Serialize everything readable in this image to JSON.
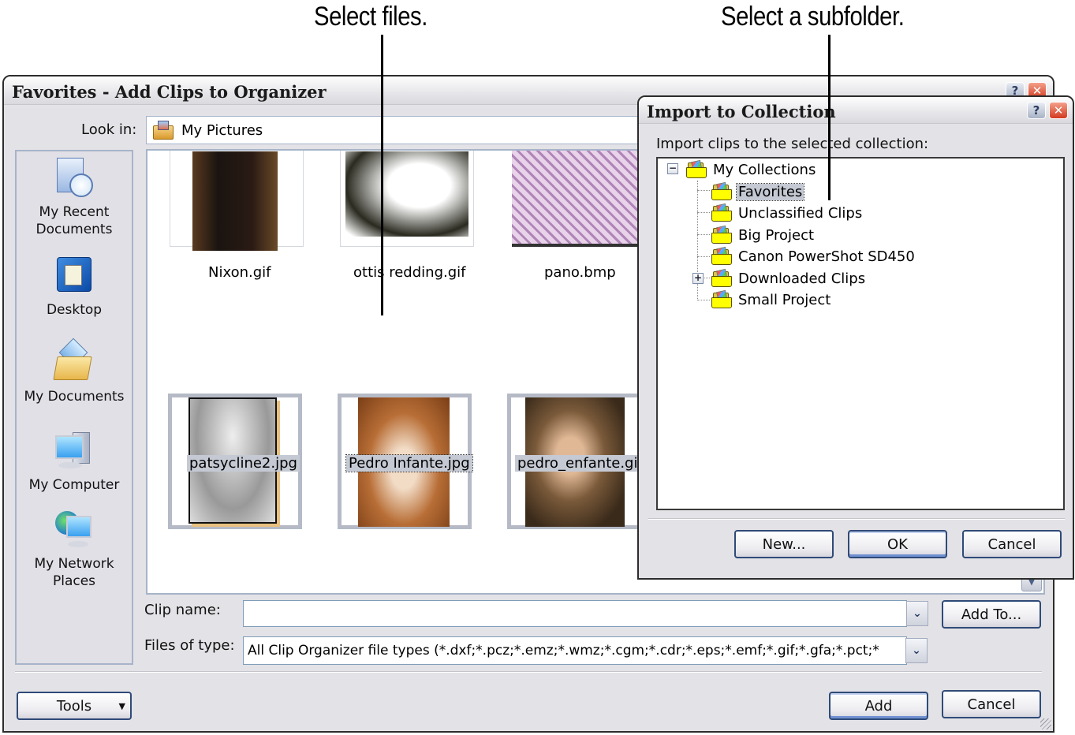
{
  "callouts": {
    "select_files": "Select files.",
    "select_subfolder": "Select a subfolder."
  },
  "main_window": {
    "title": "Favorites - Add Clips to Organizer",
    "help_label": "?",
    "close_label": "✕",
    "look_in_label": "Look in:",
    "look_in_value": "My Pictures",
    "places": [
      {
        "label": "My Recent Documents",
        "icon": "recent-documents-icon"
      },
      {
        "label": "Desktop",
        "icon": "desktop-icon"
      },
      {
        "label": "My Documents",
        "icon": "my-documents-icon"
      },
      {
        "label": "My Computer",
        "icon": "my-computer-icon"
      },
      {
        "label": "My Network Places",
        "icon": "network-places-icon"
      }
    ],
    "files": [
      {
        "name": "Nixon.gif",
        "selected": false
      },
      {
        "name": "ottis redding.gif",
        "selected": false
      },
      {
        "name": "pano.bmp",
        "selected": false
      },
      {
        "name": "patsycline2.jpg",
        "selected": true
      },
      {
        "name": "Pedro Infante.jpg",
        "selected": true,
        "focused": true
      },
      {
        "name": "pedro_enfante.gif",
        "selected": true
      }
    ],
    "clip_name_label": "Clip name:",
    "clip_name_value": "",
    "files_of_type_label": "Files of type:",
    "files_of_type_value": "All Clip Organizer file types  (*.dxf;*.pcz;*.emz;*.wmz;*.cgm;*.cdr;*.eps;*.emf;*.gif;*.gfa;*.pct;*",
    "add_to_button": "Add To...",
    "tools_button": "Tools",
    "add_button": "Add",
    "cancel_button": "Cancel"
  },
  "import_dialog": {
    "title": "Import to Collection",
    "help_label": "?",
    "close_label": "✕",
    "instruction": "Import clips to the selected collection:",
    "tree": {
      "root": {
        "label": "My Collections",
        "expanded": true
      },
      "children": [
        {
          "label": "Favorites",
          "selected": true,
          "expandable": false
        },
        {
          "label": "Unclassified Clips",
          "selected": false,
          "expandable": false
        },
        {
          "label": "Big Project",
          "selected": false,
          "expandable": false
        },
        {
          "label": "Canon PowerShot SD450",
          "selected": false,
          "expandable": false
        },
        {
          "label": "Downloaded Clips",
          "selected": false,
          "expandable": true
        },
        {
          "label": "Small Project",
          "selected": false,
          "expandable": false
        }
      ]
    },
    "new_button": "New...",
    "ok_button": "OK",
    "cancel_button": "Cancel"
  }
}
